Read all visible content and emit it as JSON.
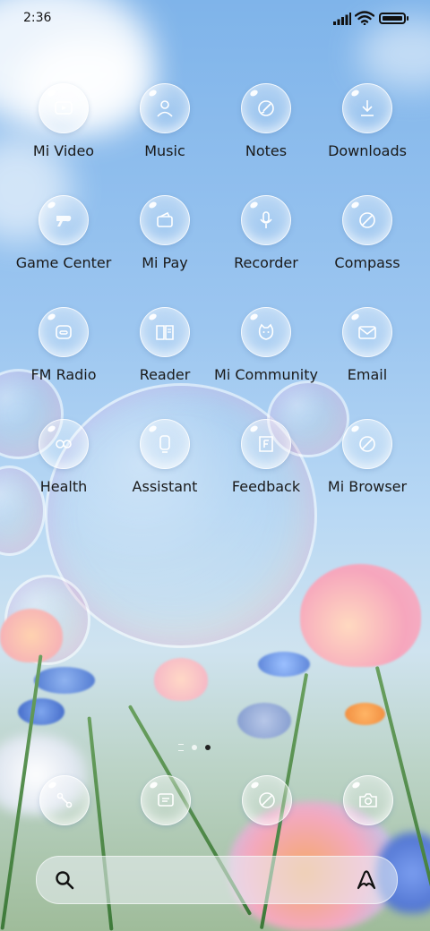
{
  "status_bar": {
    "time": "2:36",
    "icons": [
      "signal-icon",
      "wifi-icon",
      "battery-icon"
    ]
  },
  "apps": [
    {
      "label": "Mi Video",
      "icon": "video-icon"
    },
    {
      "label": "Music",
      "icon": "person-icon"
    },
    {
      "label": "Notes",
      "icon": "notes-icon"
    },
    {
      "label": "Downloads",
      "icon": "download-icon"
    },
    {
      "label": "Game Center",
      "icon": "game-icon"
    },
    {
      "label": "Mi Pay",
      "icon": "wallet-icon"
    },
    {
      "label": "Recorder",
      "icon": "microphone-icon"
    },
    {
      "label": "Compass",
      "icon": "compass-icon"
    },
    {
      "label": "FM Radio",
      "icon": "radio-icon"
    },
    {
      "label": "Reader",
      "icon": "book-icon"
    },
    {
      "label": "Mi Community",
      "icon": "community-icon"
    },
    {
      "label": "Email",
      "icon": "mail-icon"
    },
    {
      "label": "Health",
      "icon": "health-icon"
    },
    {
      "label": "Assistant",
      "icon": "assistant-icon"
    },
    {
      "label": "Feedback",
      "icon": "feedback-icon"
    },
    {
      "label": "Mi Browser",
      "icon": "browser-icon"
    }
  ],
  "page_indicator": {
    "pages": 2,
    "active": 2
  },
  "dock": [
    {
      "icon": "phone-icon"
    },
    {
      "icon": "messages-icon"
    },
    {
      "icon": "browser-icon"
    },
    {
      "icon": "camera-icon"
    }
  ],
  "search_bar": {
    "left_icon": "search-icon",
    "right_icon": "assistant-logo-icon"
  }
}
